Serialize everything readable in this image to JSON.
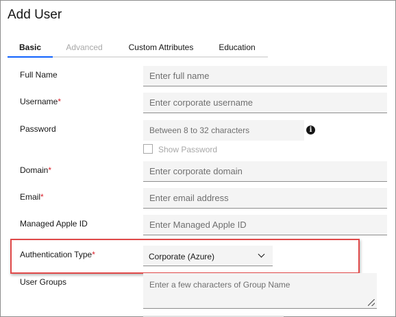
{
  "dialog": {
    "title": "Add User"
  },
  "tabs": [
    {
      "label": "Basic",
      "state": "active"
    },
    {
      "label": "Advanced",
      "state": "disabled"
    },
    {
      "label": "Custom Attributes",
      "state": "normal"
    },
    {
      "label": "Education",
      "state": "normal"
    }
  ],
  "form": {
    "full_name": {
      "label": "Full Name",
      "placeholder": "Enter full name",
      "required": false
    },
    "username": {
      "label": "Username",
      "placeholder": "Enter corporate username",
      "required": true
    },
    "password": {
      "label": "Password",
      "placeholder": "Between 8 to 32 characters",
      "required": false,
      "info_icon": "info-icon",
      "show_password_label": "Show Password",
      "show_password_checked": false
    },
    "domain": {
      "label": "Domain",
      "placeholder": "Enter corporate domain",
      "required": true
    },
    "email": {
      "label": "Email",
      "placeholder": "Enter email address",
      "required": true
    },
    "managed_apple_id": {
      "label": "Managed Apple ID",
      "placeholder": "Enter Managed Apple ID",
      "required": false
    },
    "authentication_type": {
      "label": "Authentication Type",
      "value": "Corporate (Azure)",
      "required": true
    },
    "user_groups": {
      "label": "User Groups",
      "placeholder": "Enter a few characters of Group Name",
      "required": false
    }
  },
  "required_marker": "*",
  "colors": {
    "active_tab_underline": "#0f62fe",
    "required": "#da1e28",
    "highlight_box": "#e04848",
    "field_bg": "#f4f4f4"
  }
}
